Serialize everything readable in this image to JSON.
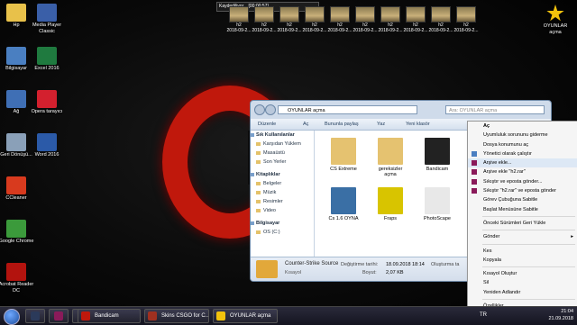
{
  "desktop": {
    "icons_left": [
      {
        "label": "Hp",
        "color": "#e8c14a"
      },
      {
        "label": "Bilgisayar",
        "color": "#4a7fc1"
      },
      {
        "label": "Ağ",
        "color": "#3f6fb5"
      },
      {
        "label": "Geri Dönüşü...",
        "color": "#8aa0b8"
      },
      {
        "label": "CCleaner",
        "color": "#d83a1e"
      },
      {
        "label": "Google Chrome",
        "color": "#3b9a3b"
      },
      {
        "label": "Acrobat Reader DC",
        "color": "#b3130e"
      }
    ],
    "icons_col2": [
      {
        "label": "Media Player Classic",
        "color": "#3a5fa8"
      },
      {
        "label": "Excel 2016",
        "color": "#1f7a3f"
      },
      {
        "label": "Opera tarayıcı",
        "color": "#d3202e"
      },
      {
        "label": "Word 2016",
        "color": "#2b5aa8"
      }
    ],
    "icon_right": {
      "label": "OYUNLAR açma",
      "color": "#f2c20c"
    }
  },
  "recording": {
    "label": "Kaydediliyor... [00:00:57]"
  },
  "thumbs": [
    {
      "label": "h2\n2018-09-2..."
    },
    {
      "label": "h2\n2018-09-2..."
    },
    {
      "label": "h2\n2018-09-2..."
    },
    {
      "label": "h2\n2018-09-2..."
    },
    {
      "label": "h2\n2018-09-2..."
    },
    {
      "label": "h2\n2018-09-2..."
    },
    {
      "label": "h2\n2018-09-2..."
    },
    {
      "label": "h2\n2018-09-2..."
    },
    {
      "label": "h2\n2018-09-2..."
    },
    {
      "label": "h2\n2018-09-2..."
    }
  ],
  "explorer": {
    "address": "OYUNLAR açma",
    "search_placeholder": "Ara: OYUNLAR açma",
    "toolbar": {
      "organize": "Düzenle",
      "open": "Aç",
      "share": "Bununla paylaş",
      "print": "Yaz",
      "new_folder": "Yeni klasör"
    },
    "sidebar": [
      {
        "label": "Sık Kullanılanlar",
        "header": true
      },
      {
        "label": "Karşıdan Yüklem",
        "header": false
      },
      {
        "label": "Masaüstü",
        "header": false
      },
      {
        "label": "Son Yerler",
        "header": false
      },
      {
        "label": "Kitaplıklar",
        "header": true
      },
      {
        "label": "Belgeler",
        "header": false
      },
      {
        "label": "Müzik",
        "header": false
      },
      {
        "label": "Resimler",
        "header": false
      },
      {
        "label": "Video",
        "header": false
      },
      {
        "label": "Bilgisayar",
        "header": true
      },
      {
        "label": "OS (C:)",
        "header": false
      }
    ],
    "files": [
      {
        "label": "CS Extreme",
        "color": "#e5c270"
      },
      {
        "label": "gereksizler açma",
        "color": "#e5c270"
      },
      {
        "label": "Bandicam",
        "color": "#222222"
      },
      {
        "label": "Cs 1.6 OYNA",
        "color": "#3a6fa5"
      },
      {
        "label": "Fraps",
        "color": "#d8c400"
      },
      {
        "label": "PhotoScape",
        "color": "#e8e8e8"
      }
    ],
    "status": {
      "name": "Counter-Strike Source",
      "type": "Kısayol",
      "modified_label": "Değiştirme tarihi:",
      "modified_value": "18.09.2018 18:14",
      "size_label": "Boyut:",
      "size_value": "2,07 KB",
      "extra": "Oluşturma ta"
    }
  },
  "context_menu": {
    "items": [
      {
        "label": "Aç",
        "bold": true,
        "sep_after": false,
        "submenu": false,
        "highlight": false,
        "icon": ""
      },
      {
        "label": "Uyumluluk sorununu giderme",
        "bold": false,
        "sep_after": false,
        "submenu": false,
        "highlight": false,
        "icon": ""
      },
      {
        "label": "Dosya konumunu aç",
        "bold": false,
        "sep_after": false,
        "submenu": false,
        "highlight": false,
        "icon": ""
      },
      {
        "label": "Yönetici olarak çalıştır",
        "bold": false,
        "sep_after": false,
        "submenu": false,
        "highlight": false,
        "icon": "#4a7fc1"
      },
      {
        "label": "Arşive ekle...",
        "bold": false,
        "sep_after": false,
        "submenu": false,
        "highlight": true,
        "icon": "#8a1a5a"
      },
      {
        "label": "Arşive ekle \"h2.rar\"",
        "bold": false,
        "sep_after": false,
        "submenu": false,
        "highlight": false,
        "icon": "#8a1a5a"
      },
      {
        "label": "Sıkıştır ve eposta gönder...",
        "bold": false,
        "sep_after": false,
        "submenu": false,
        "highlight": false,
        "icon": "#8a1a5a"
      },
      {
        "label": "Sıkıştır \"h2.rar\" ve eposta gönder",
        "bold": false,
        "sep_after": false,
        "submenu": false,
        "highlight": false,
        "icon": "#8a1a5a"
      },
      {
        "label": "Görev Çubuğuna Sabitle",
        "bold": false,
        "sep_after": false,
        "submenu": false,
        "highlight": false,
        "icon": ""
      },
      {
        "label": "Başlat Menüsüne Sabitle",
        "bold": false,
        "sep_after": true,
        "submenu": false,
        "highlight": false,
        "icon": ""
      },
      {
        "label": "Önceki Sürümleri Geri Yükle",
        "bold": false,
        "sep_after": true,
        "submenu": false,
        "highlight": false,
        "icon": ""
      },
      {
        "label": "Gönder",
        "bold": false,
        "sep_after": true,
        "submenu": true,
        "highlight": false,
        "icon": ""
      },
      {
        "label": "Kes",
        "bold": false,
        "sep_after": false,
        "submenu": false,
        "highlight": false,
        "icon": ""
      },
      {
        "label": "Kopyala",
        "bold": false,
        "sep_after": true,
        "submenu": false,
        "highlight": false,
        "icon": ""
      },
      {
        "label": "Kısayol Oluştur",
        "bold": false,
        "sep_after": false,
        "submenu": false,
        "highlight": false,
        "icon": ""
      },
      {
        "label": "Sil",
        "bold": false,
        "sep_after": false,
        "submenu": false,
        "highlight": false,
        "icon": ""
      },
      {
        "label": "Yeniden Adlandır",
        "bold": false,
        "sep_after": true,
        "submenu": false,
        "highlight": false,
        "icon": ""
      },
      {
        "label": "Özellikler",
        "bold": false,
        "sep_after": false,
        "submenu": false,
        "highlight": false,
        "icon": ""
      }
    ]
  },
  "taskbar": {
    "pinned": [
      {
        "name": "media-player-taskbar-icon",
        "color": "#2b3a5a"
      },
      {
        "name": "winrar-taskbar-icon",
        "color": "#8a1a5a"
      },
      {
        "name": "chrome-taskbar-icon",
        "color": "#3b9a3b"
      }
    ],
    "windows": [
      {
        "label": "Bandicam",
        "color": "#c0180c"
      },
      {
        "label": "Skins CSGO for C...",
        "color": "#a03020"
      },
      {
        "label": "OYUNLAR açma",
        "color": "#f2c20c"
      }
    ],
    "lang": "TR",
    "time": "21:04",
    "date": "21.09.2018"
  }
}
